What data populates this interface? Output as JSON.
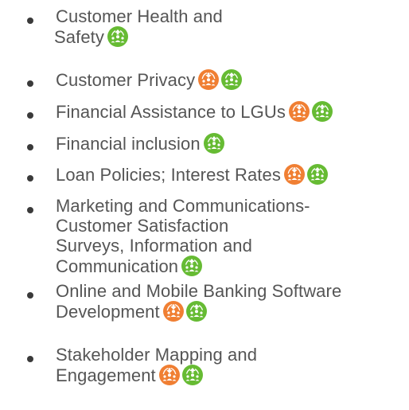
{
  "colors": {
    "text": "#555555",
    "bullet": "#3a3a3a",
    "orange_icon": "#f07f33",
    "green_icon": "#66bb33"
  },
  "icon_types": {
    "orange": "orange-people-down-icon",
    "green": "green-people-up-icon"
  },
  "items": [
    {
      "lines": [
        "Customer Health and",
        "Safety"
      ],
      "icons": [
        "green"
      ]
    },
    {
      "lines": [
        "Customer Privacy"
      ],
      "icons": [
        "orange",
        "green"
      ]
    },
    {
      "lines": [
        "Financial Assistance to LGUs"
      ],
      "icons": [
        "orange",
        "green"
      ]
    },
    {
      "lines": [
        "Financial inclusion"
      ],
      "icons": [
        "green"
      ]
    },
    {
      "lines": [
        "Loan Policies; Interest Rates"
      ],
      "icons": [
        "orange",
        "green"
      ]
    },
    {
      "lines": [
        "Marketing and Communications-",
        "Customer Satisfaction",
        "Surveys, Information and",
        "Communication"
      ],
      "icons": [
        "green"
      ]
    },
    {
      "lines": [
        "Online and Mobile Banking Software",
        "Development"
      ],
      "icons": [
        "orange",
        "green"
      ]
    },
    {
      "lines": [
        "Stakeholder Mapping and",
        "Engagement"
      ],
      "icons": [
        "orange",
        "green"
      ]
    }
  ]
}
